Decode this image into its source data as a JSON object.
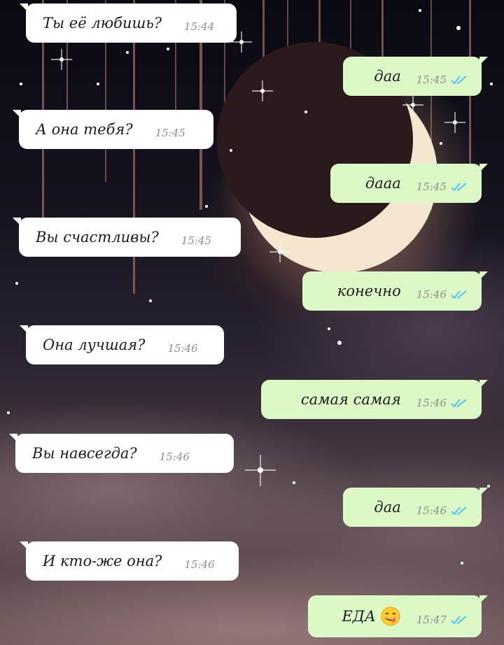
{
  "colors": {
    "incoming_bubble": "#ffffff",
    "outgoing_bubble": "#dcf8c6",
    "read_ticks": "#4fc3f7"
  },
  "messages": [
    {
      "direction": "incoming",
      "text": "Ты её любишь?",
      "time": "15:44"
    },
    {
      "direction": "outgoing",
      "text": "даа",
      "time": "15:45",
      "status": "read-double-check-icon"
    },
    {
      "direction": "incoming",
      "text": "А она тебя?",
      "time": "15:45"
    },
    {
      "direction": "outgoing",
      "text": "дааа",
      "time": "15:45",
      "status": "read-double-check-icon"
    },
    {
      "direction": "incoming",
      "text": "Вы счастливы?",
      "time": "15:45"
    },
    {
      "direction": "outgoing",
      "text": "конечно",
      "time": "15:46",
      "status": "read-double-check-icon"
    },
    {
      "direction": "incoming",
      "text": "Она лучшая?",
      "time": "15:46"
    },
    {
      "direction": "outgoing",
      "text": "самая самая",
      "time": "15:46",
      "status": "read-double-check-icon"
    },
    {
      "direction": "incoming",
      "text": "Вы навсегда?",
      "time": "15:46"
    },
    {
      "direction": "outgoing",
      "text": "даа",
      "time": "15:46",
      "status": "read-double-check-icon"
    },
    {
      "direction": "incoming",
      "text": "И кто-же она?",
      "time": "15:46"
    },
    {
      "direction": "outgoing",
      "text": "ЕДА",
      "emoji": "savoring-food-face-emoji",
      "time": "15:47",
      "status": "read-double-check-icon"
    }
  ]
}
